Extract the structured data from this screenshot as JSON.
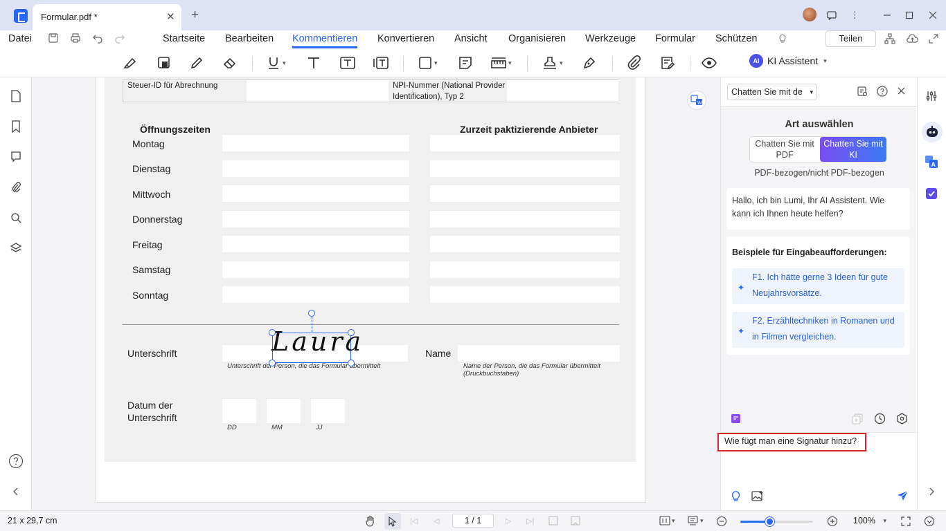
{
  "titlebar": {
    "tab_title": "Formular.pdf *"
  },
  "menu": {
    "file": "Datei",
    "items": [
      "Startseite",
      "Bearbeiten",
      "Kommentieren",
      "Konvertieren",
      "Ansicht",
      "Organisieren",
      "Werkzeuge",
      "Formular",
      "Schützen"
    ],
    "active": "Kommentieren",
    "share": "Teilen"
  },
  "toolbar": {
    "ai_badge": "AI",
    "ai_label": "KI Assistent"
  },
  "form": {
    "tax_id_label": "Steuer-ID für Abrechnung",
    "npi_label_line1": "NPI-Nummer (National Provider",
    "npi_label_line2": "Identification), Typ 2",
    "hours_header": "Öffnungszeiten",
    "providers_header": "Zurzeit paktizierende Anbieter",
    "days": [
      "Montag",
      "Dienstag",
      "Mittwoch",
      "Donnerstag",
      "Freitag",
      "Samstag",
      "Sonntag"
    ],
    "signature_label": "Unterschrift",
    "signature_value": "Laura",
    "signature_hint": "Unterschrift der Person, die das Formular übermittelt",
    "name_label": "Name",
    "name_hint_line1": "Name der Person, die das Formular übermittelt",
    "name_hint_line2": "(Druckbuchstaben)",
    "date_label_line1": "Datum der",
    "date_label_line2": "Unterschrift",
    "date_parts": [
      "DD",
      "MM",
      "JJ"
    ]
  },
  "ai_panel": {
    "mode_select": "Chatten Sie mit de",
    "art_title": "Art auswählen",
    "seg_pdf_line1": "Chatten Sie mit",
    "seg_pdf_line2": "PDF",
    "seg_ki_line1": "Chatten Sie mit",
    "seg_ki_line2": "KI",
    "seg_subtitle": "PDF-bezogen/nicht PDF-bezogen",
    "greeting": "Hallo, ich bin Lumi, Ihr AI Assistent. Wie kann ich Ihnen heute helfen?",
    "examples_title": "Beispiele für Eingabeaufforderungen:",
    "examples": [
      "F1. Ich hätte gerne 3 Ideen für gute Neujahrsvorsätze.",
      "F2. Erzähltechniken in Romanen und in Filmen vergleichen."
    ],
    "input_value": "Wie fügt man eine Signatur hinzu?"
  },
  "status": {
    "page_size": "21 x 29,7 cm",
    "page_indicator": "1 / 1",
    "zoom": "100%",
    "zoom_fraction": 0.4
  },
  "colors": {
    "accent": "#2a66f6",
    "highlight_border": "#d7262d",
    "ai_gradient_start": "#7b4cf0",
    "ai_gradient_end": "#3a7bf5"
  }
}
